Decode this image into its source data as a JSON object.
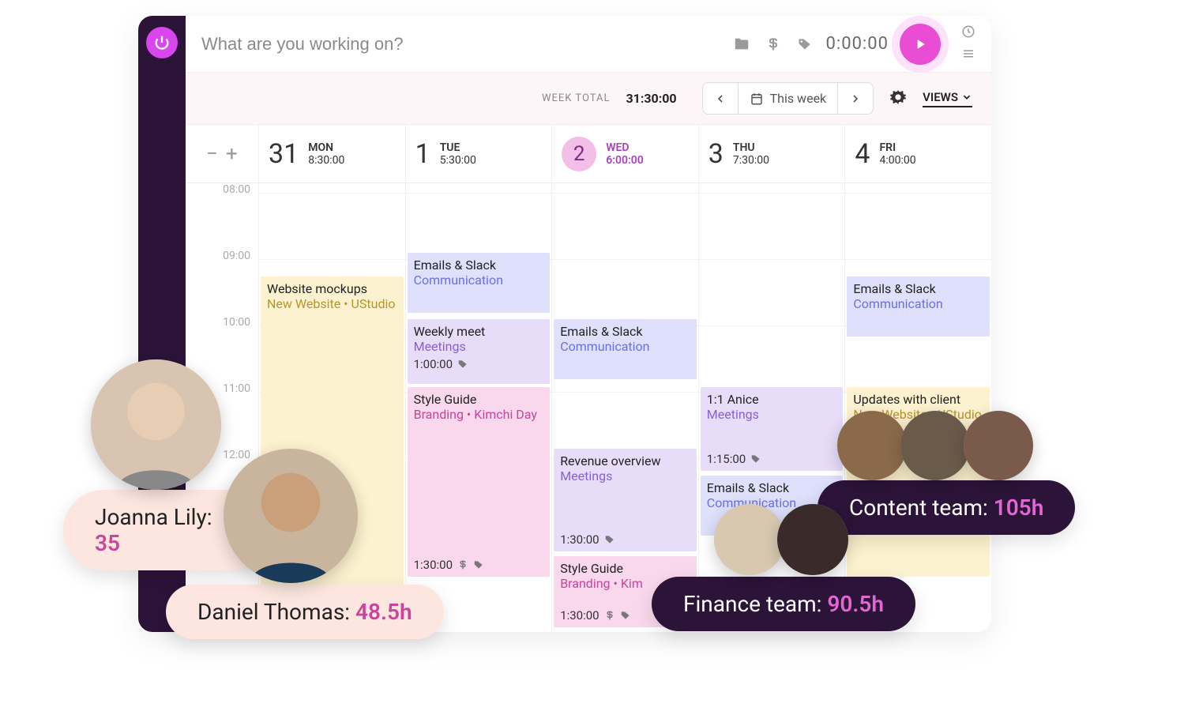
{
  "topbar": {
    "placeholder": "What are you working on?",
    "timer": "0:00:00"
  },
  "subbar": {
    "week_total_label": "WEEK TOTAL",
    "week_total_value": "31:30:00",
    "week_label": "This week",
    "views_label": "VIEWS"
  },
  "days": [
    {
      "num": "31",
      "dow": "MON",
      "dur": "8:30:00",
      "today": false
    },
    {
      "num": "1",
      "dow": "TUE",
      "dur": "5:30:00",
      "today": false
    },
    {
      "num": "2",
      "dow": "WED",
      "dur": "6:00:00",
      "today": true
    },
    {
      "num": "3",
      "dow": "THU",
      "dur": "7:30:00",
      "today": false
    },
    {
      "num": "4",
      "dow": "FRI",
      "dur": "4:00:00",
      "today": false
    }
  ],
  "hours": [
    "08:00",
    "09:00",
    "10:00",
    "11:00",
    "12:00"
  ],
  "events": {
    "mon": [
      {
        "title": "Website mockups",
        "project": "New Website",
        "client": "UStudio",
        "color": "yellow"
      }
    ],
    "tue": [
      {
        "title": "Emails & Slack",
        "project": "Communication",
        "color": "lav"
      },
      {
        "title": "Weekly meet",
        "project": "Meetings",
        "time": "1:00:00",
        "color": "purple"
      },
      {
        "title": "Style Guide",
        "project": "Branding",
        "client": "Kimchi Day",
        "time": "1:30:00",
        "billable": true,
        "color": "pink"
      }
    ],
    "wed": [
      {
        "title": "Emails & Slack",
        "project": "Communication",
        "color": "lav"
      },
      {
        "title": "Revenue overview",
        "project": "Meetings",
        "time": "1:30:00",
        "color": "purple"
      },
      {
        "title": "Style Guide",
        "project": "Branding",
        "client": "Kim",
        "time": "1:30:00",
        "billable": true,
        "color": "pink"
      }
    ],
    "thu": [
      {
        "title": "1:1 Anice",
        "project": "Meetings",
        "time": "1:15:00",
        "color": "purple"
      },
      {
        "title": "Emails & Slack",
        "project": "Communication",
        "color": "lav"
      }
    ],
    "fri": [
      {
        "title": "Emails & Slack",
        "project": "Communication",
        "color": "lav"
      },
      {
        "title": "Updates with client",
        "project": "New Website",
        "client": "UStudio",
        "color": "yellow"
      }
    ]
  },
  "overlays": {
    "joanna": {
      "name": "Joanna Lily:",
      "hours": "35"
    },
    "daniel": {
      "name": "Daniel Thomas:",
      "hours": "48.5h"
    },
    "content": {
      "name": "Content team:",
      "hours": "105h"
    },
    "finance": {
      "name": "Finance team:",
      "hours": "90.5h"
    }
  }
}
